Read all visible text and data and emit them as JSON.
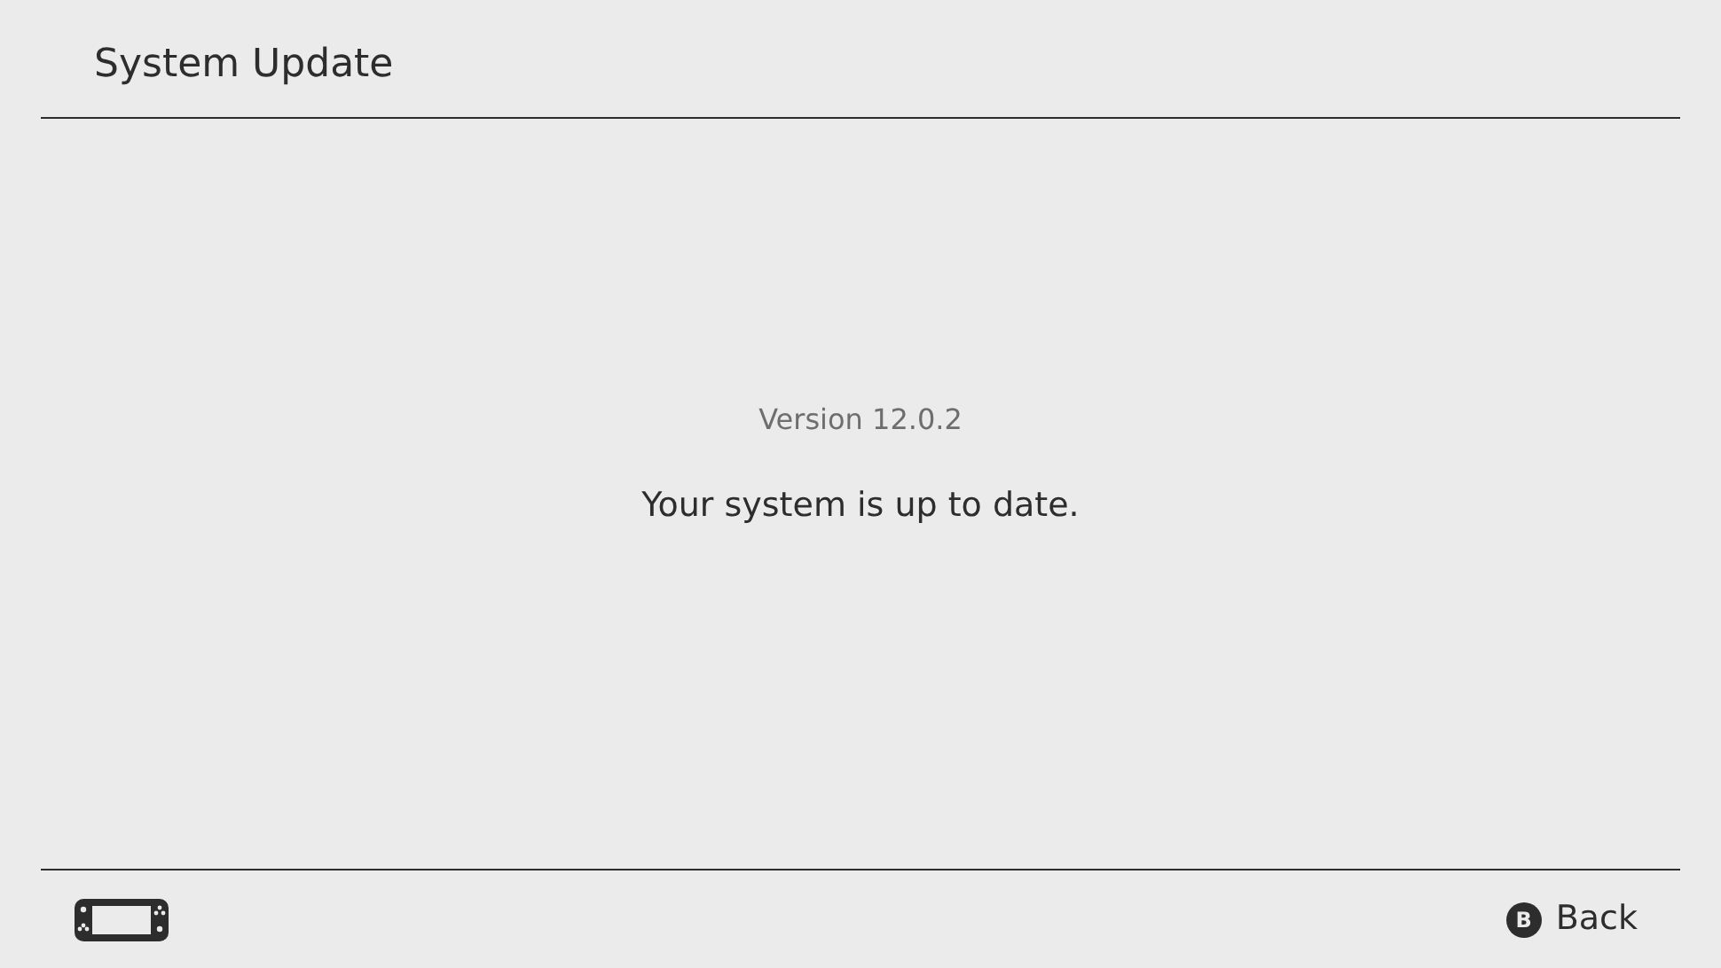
{
  "header": {
    "title": "System Update"
  },
  "content": {
    "version": "Version 12.0.2",
    "message": "Your system is up to date."
  },
  "footer": {
    "back_button": {
      "glyph": "B",
      "label": "Back"
    }
  }
}
